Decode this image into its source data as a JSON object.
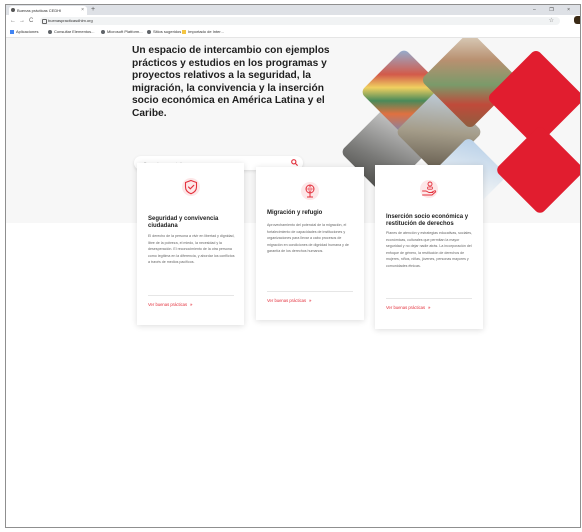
{
  "browser": {
    "tab_title": "Buenas prácticas CEDHI",
    "tab_close": "×",
    "new_tab": "+",
    "window_controls": "– ❐ ×",
    "url": "buenaspracticasdhlm.org",
    "nav_back": "←",
    "nav_forward": "→",
    "nav_reload": "C",
    "star": "☆",
    "bookmarks": [
      {
        "label": "Aplicaciones",
        "icon": "apps-grid-icon",
        "color": "#4285f4"
      },
      {
        "label": "Consultar Elementos...",
        "icon": "globe-icon",
        "color": "#5f6368"
      },
      {
        "label": "Microsoft Platform...",
        "icon": "globe-icon",
        "color": "#5f6368"
      },
      {
        "label": "Sitios sugeridos",
        "icon": "globe-icon",
        "color": "#5f6368"
      },
      {
        "label": "Importado de Inter...",
        "icon": "folder-icon",
        "color": "#f4c542"
      }
    ]
  },
  "hero": {
    "headline": "Un espacio de intercambio con ejemplos prácticos y estudios en los programas y proyectos relativos a la seguridad, la migración, la convivencia y la inserción socio económica en América Latina y el Caribe.",
    "search_placeholder": "Buscar buenas prácticas"
  },
  "colors": {
    "accent": "#e3303c",
    "text": "#1f1f1f",
    "hero_bg": "#f7f7f7"
  },
  "cards": [
    {
      "icon": "shield-icon",
      "title": "Seguridad y convivencia ciudadana",
      "description": "El derecho de la persona a vivir en libertad y dignidad, libre de la pobreza, el miedo, la necesidad y la desesperación. El reconocimiento de la otra persona como legítima en la diferencia, y abordar los conflictos a través de medios pacíficos.",
      "link": "Ver buenas prácticas",
      "arrow": "»"
    },
    {
      "icon": "globe-pin-icon",
      "title": "Migración y refugio",
      "description": "Aprovechamiento del potencial de la migración, el fortalecimiento de capacidades de instituciones y organizaciones para llevar a cabo procesos de migración en condiciones de dignidad humana y de garantía de los derechos humanos.",
      "link": "Ver buenas prácticas",
      "arrow": "»"
    },
    {
      "icon": "hand-coins-icon",
      "title": "Inserción socio económica y restitución de derechos",
      "description": "Planes de atención y estrategias educativas, sociales, económicas, culturales que permitan la mayor seguridad y no dejar nadie atrás. La incorporación del enfoque de género, la restitución de derechos de mujeres, niños, niñas, jóvenes, personas mayores y comunidades étnicas.",
      "link": "Ver buenas prácticas",
      "arrow": "»"
    }
  ]
}
